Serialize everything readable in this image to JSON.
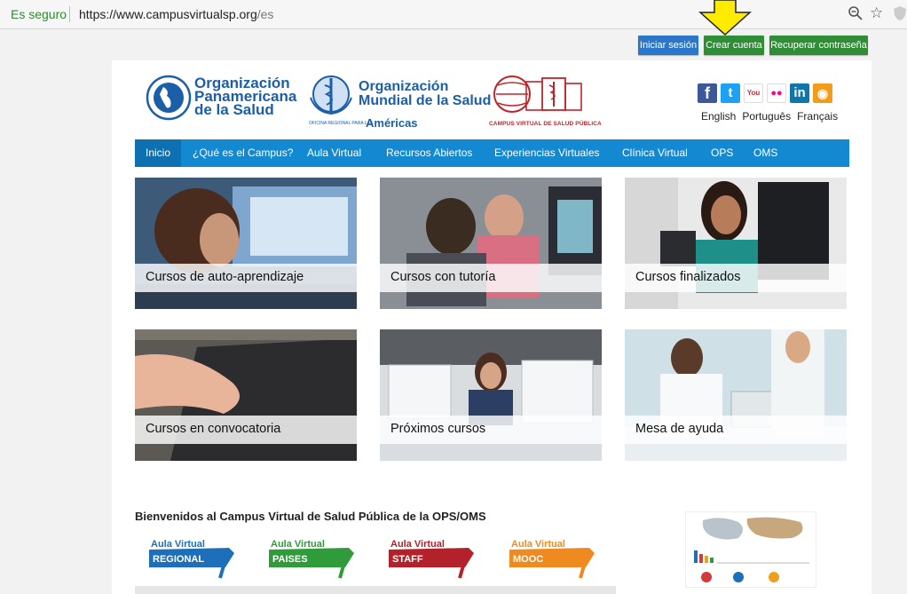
{
  "address_bar": {
    "secure_label": "Es seguro",
    "url_main": "https://www.campusvirtualsp.org",
    "url_path": "/es",
    "zoom_icon": "zoom-icon",
    "star_icon": "bookmark-star-icon"
  },
  "top_buttons": {
    "login": "Iniciar sesión",
    "create": "Crear cuenta",
    "recover": "Recuperar contraseña"
  },
  "header": {
    "ops_name": [
      "Organización",
      "Panamericana",
      "de la Salud"
    ],
    "oms_name": [
      "Organización",
      "Mundial de la Salud"
    ],
    "oms_sub": "OFICINA REGIONAL PARA LAS",
    "oms_americas": "Américas",
    "campus_name": "CAMPUS VIRTUAL DE SALUD PÚBLICA",
    "social": [
      {
        "icon": "facebook-icon",
        "glyph": "f",
        "color": "#3b5998"
      },
      {
        "icon": "twitter-icon",
        "glyph": "t",
        "color": "#1da1f2"
      },
      {
        "icon": "youtube-icon",
        "glyph": "You",
        "color": "#d32a2a"
      },
      {
        "icon": "flickr-icon",
        "glyph": "●●",
        "color": "#ffffff"
      },
      {
        "icon": "linkedin-icon",
        "glyph": "in",
        "color": "#0e76a8"
      },
      {
        "icon": "rss-icon",
        "glyph": "◉",
        "color": "#f39b1b"
      }
    ],
    "languages": [
      "English",
      "Português",
      "Français"
    ]
  },
  "nav": {
    "items": [
      "Inicio",
      "¿Qué es el Campus?",
      "Aula Virtual",
      "Recursos Abiertos",
      "Experiencias Virtuales",
      "Clínica Virtual",
      "OPS",
      "OMS"
    ],
    "active": "Inicio"
  },
  "tiles": [
    {
      "label": "Cursos de auto-aprendizaje"
    },
    {
      "label": "Cursos con tutoría"
    },
    {
      "label": "Cursos finalizados"
    },
    {
      "label": "Cursos en convocatoria"
    },
    {
      "label": "Próximos cursos"
    },
    {
      "label": "Mesa de ayuda"
    }
  ],
  "welcome": "Bienvenidos al Campus Virtual de Salud Pública de la OPS/OMS",
  "aula_banners": [
    {
      "top": "Aula Virtual",
      "bottom": "REGIONAL",
      "color": "#1c6fb8"
    },
    {
      "top": "Aula Virtual",
      "bottom": "PAISES",
      "color": "#2f9b3a"
    },
    {
      "top": "Aula Virtual",
      "bottom": "STAFF",
      "color": "#b3222a"
    },
    {
      "top": "Aula Virtual",
      "bottom": "MOOC",
      "color": "#ee8a1f"
    }
  ]
}
